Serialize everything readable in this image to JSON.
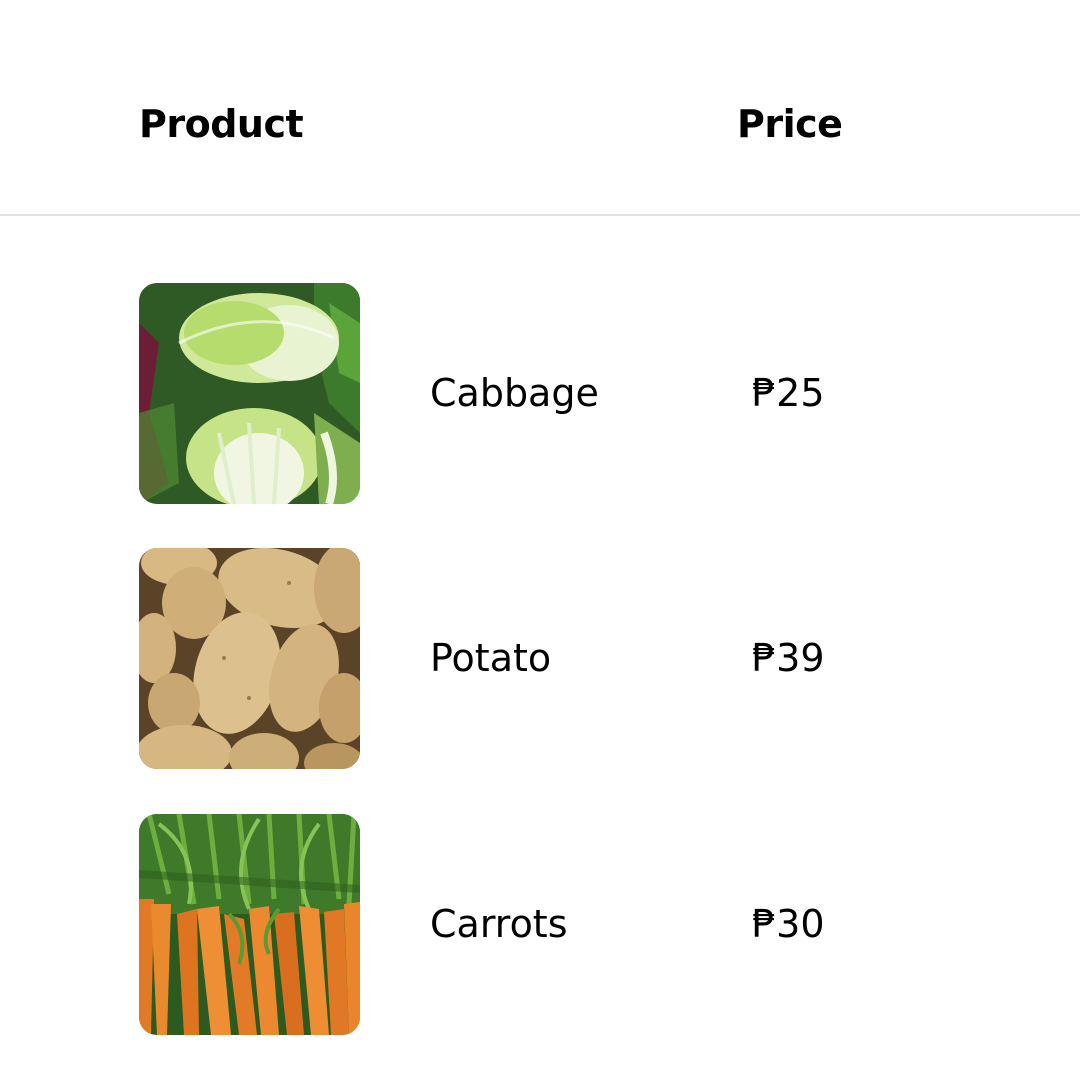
{
  "table": {
    "headers": {
      "product": "Product",
      "price": "Price"
    },
    "rows": [
      {
        "name": "Cabbage",
        "price": "₱25",
        "image": "cabbage-image"
      },
      {
        "name": "Potato",
        "price": "₱39",
        "image": "potato-image"
      },
      {
        "name": "Carrots",
        "price": "₱30",
        "image": "carrots-image"
      }
    ]
  }
}
